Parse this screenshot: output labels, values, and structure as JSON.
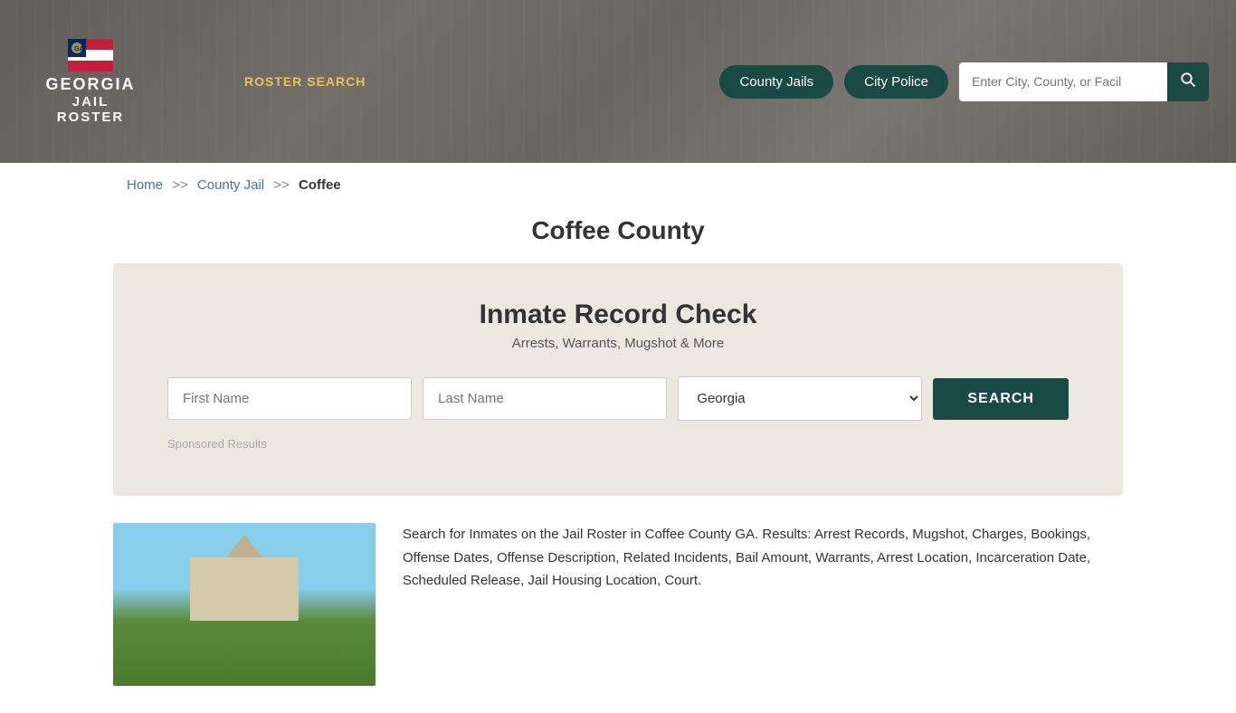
{
  "header": {
    "logo_georgia": "GEORGIA",
    "logo_jail": "JAIL",
    "logo_roster": "ROSTER",
    "nav_roster_search": "ROSTER SEARCH",
    "btn_county_jails": "County Jails",
    "btn_city_police": "City Police",
    "search_placeholder": "Enter City, County, or Facil"
  },
  "breadcrumb": {
    "home": "Home",
    "sep1": ">>",
    "county_jail": "County Jail",
    "sep2": ">>",
    "current": "Coffee"
  },
  "page": {
    "title": "Coffee County"
  },
  "inmate_search": {
    "title": "Inmate Record Check",
    "subtitle": "Arrests, Warrants, Mugshot & More",
    "first_name_placeholder": "First Name",
    "last_name_placeholder": "Last Name",
    "state_value": "Georgia",
    "search_btn": "SEARCH",
    "sponsored_label": "Sponsored Results"
  },
  "bottom": {
    "description": "Search for Inmates on the Jail Roster in Coffee County GA. Results: Arrest Records, Mugshot, Charges, Bookings, Offense Dates, Offense Description, Related Incidents, Bail Amount, Warrants, Arrest Location, Incarceration Date, Scheduled Release, Jail Housing Location, Court."
  }
}
